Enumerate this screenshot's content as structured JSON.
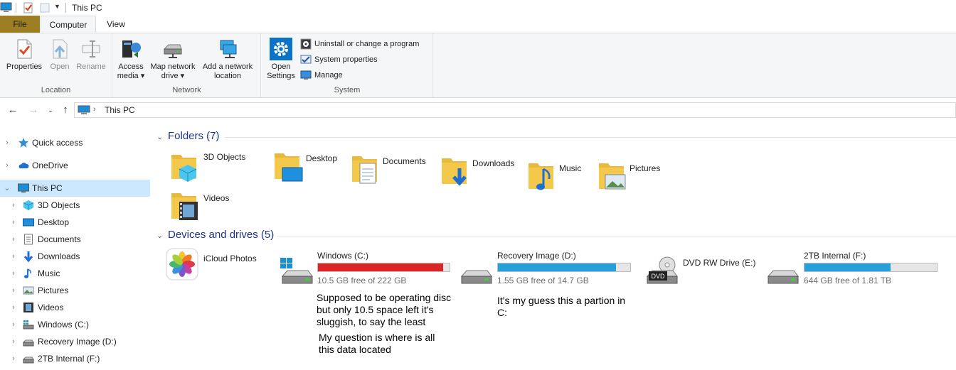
{
  "window": {
    "title": "This PC"
  },
  "ribbon": {
    "tabs": {
      "file": "File",
      "computer": "Computer",
      "view": "View"
    },
    "location": {
      "label": "Location",
      "properties": "Properties",
      "open": "Open",
      "rename": "Rename"
    },
    "network": {
      "label": "Network",
      "access_media_1": "Access",
      "access_media_2": "media",
      "map_drive_1": "Map network",
      "map_drive_2": "drive",
      "add_location_1": "Add a network",
      "add_location_2": "location"
    },
    "system": {
      "label": "System",
      "open_settings_1": "Open",
      "open_settings_2": "Settings",
      "uninstall": "Uninstall or change a program",
      "system_properties": "System properties",
      "manage": "Manage"
    }
  },
  "address": {
    "crumb": "This PC"
  },
  "nav": {
    "quick_access": "Quick access",
    "onedrive": "OneDrive",
    "this_pc": "This PC",
    "objects3d": "3D Objects",
    "desktop": "Desktop",
    "documents": "Documents",
    "downloads": "Downloads",
    "music": "Music",
    "pictures": "Pictures",
    "videos": "Videos",
    "windows_c": "Windows (C:)",
    "recovery_d": "Recovery Image (D:)",
    "internal_f": "2TB Internal (F:)"
  },
  "folders": {
    "header": "Folders (7)",
    "items": [
      "3D Objects",
      "Desktop",
      "Documents",
      "Downloads",
      "Music",
      "Pictures",
      "Videos"
    ]
  },
  "devices": {
    "header": "Devices and drives (5)",
    "icloud": "iCloud Photos",
    "drives": [
      {
        "name": "Windows (C:)",
        "free": "10.5 GB free of 222 GB",
        "used_fraction": 0.953,
        "color": "#da2626"
      },
      {
        "name": "Recovery Image (D:)",
        "free": "1.55 GB free of 14.7 GB",
        "used_fraction": 0.895,
        "color": "#26a0da"
      },
      {
        "name": "DVD RW Drive (E:)"
      },
      {
        "name": "2TB Internal (F:)",
        "free": "644 GB free of 1.81 TB",
        "used_fraction": 0.653,
        "color": "#26a0da"
      }
    ]
  },
  "annotations": {
    "note1_l1": "Supposed to be operating disc",
    "note1_l2": "but only 10.5 space left it's",
    "note1_l3": "sluggish, to say the least",
    "note2_l1": "My question is where is all",
    "note2_l2": "this data located",
    "note3_l1": "It's my guess this a partion in",
    "note3_l2": "C:"
  },
  "icons": {
    "dvd_badge": "DVD",
    "colors": {
      "folder": "#f3c84b",
      "accent": "#1e3287",
      "selection": "#cce8ff",
      "file_tab": "#9e7e22"
    }
  }
}
